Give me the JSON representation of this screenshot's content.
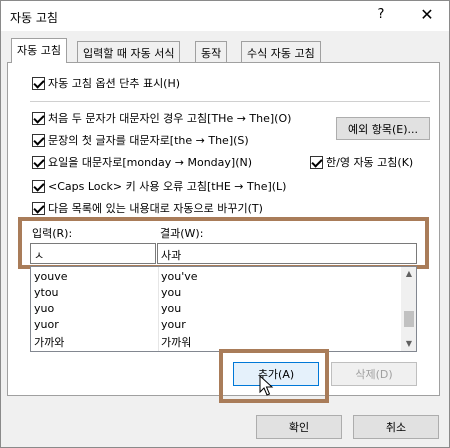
{
  "window": {
    "title": "자동 고침",
    "help_glyph": "?",
    "close_glyph": "✕"
  },
  "tabs": [
    {
      "label": "자동 고침"
    },
    {
      "label": "입력할 때 자동 서식"
    },
    {
      "label": "동작"
    },
    {
      "label": "수식 자동 고침"
    }
  ],
  "options": {
    "show_buttons": "자동 고침 옵션 단추 표시(H)",
    "two_initial_caps": "처음 두 문자가 대문자인 경우 고침[THe → The](O)",
    "first_letter_sentence": "문장의 첫 글자를 대문자로[the → The](S)",
    "day_names": "요일을 대문자로[monday → Monday](N)",
    "hangul_english": "한/영 자동 고침(K)",
    "caps_lock": "<Caps Lock> 키 사용 오류 고침[tHE → The](L)",
    "replace_text": "다음 목록에 있는 내용대로 자동으로 바꾸기(T)"
  },
  "exceptions_button": "예외 항목(E)...",
  "replace_label": "입력(R):",
  "with_label": "결과(W):",
  "replace_value": "ㅅ",
  "with_value": "사과",
  "entries": [
    {
      "from": "youve",
      "to": "you've"
    },
    {
      "from": "ytou",
      "to": "you"
    },
    {
      "from": "yuo",
      "to": "you"
    },
    {
      "from": "yuor",
      "to": "your"
    },
    {
      "from": "가까와",
      "to": "가까워"
    }
  ],
  "add_button": "추가(A)",
  "delete_button": "삭제(D)",
  "ok_button": "확인",
  "cancel_button": "취소",
  "colors": {
    "highlight": "#a97c59",
    "focus_border": "#0078d7"
  }
}
